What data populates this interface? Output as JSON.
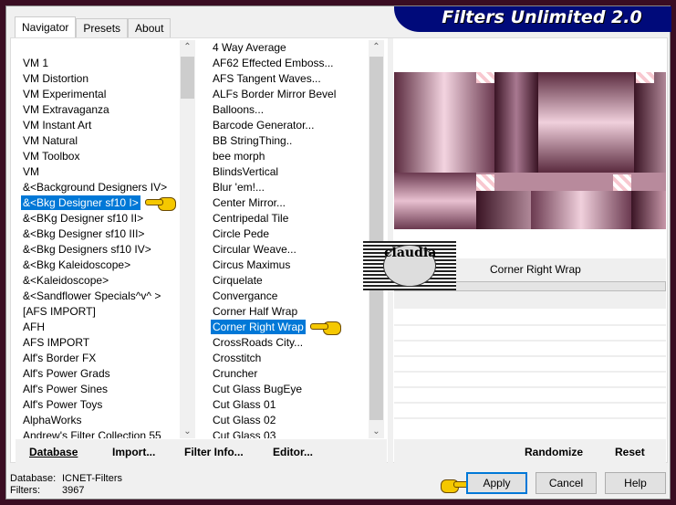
{
  "window": {
    "title": "Filters Unlimited 2.0"
  },
  "tabs": [
    {
      "label": "Navigator"
    },
    {
      "label": "Presets"
    },
    {
      "label": "About"
    }
  ],
  "categories": {
    "items": [
      "",
      "VM 1",
      "VM Distortion",
      "VM Experimental",
      "VM Extravaganza",
      "VM Instant Art",
      "VM Natural",
      "VM Toolbox",
      "VM",
      "&<Background Designers IV>",
      "&<Bkg Designer sf10 I>",
      "&<BKg Designer sf10 II>",
      "&<Bkg Designer sf10 III>",
      "&<Bkg Designers sf10 IV>",
      "&<Bkg Kaleidoscope>",
      "&<Kaleidoscope>",
      "&<Sandflower Specials^v^ >",
      "[AFS IMPORT]",
      "AFH",
      "AFS IMPORT",
      "Alf's Border FX",
      "Alf's Power Grads",
      "Alf's Power Sines",
      "Alf's Power Toys",
      "AlphaWorks",
      "Andrew's Filter Collection 55"
    ],
    "selected": "&<Bkg Designer sf10 I>"
  },
  "filters": {
    "items": [
      "4 Way Average",
      "AF62 Effected Emboss...",
      "AFS Tangent Waves...",
      "ALFs Border Mirror Bevel",
      "Balloons...",
      "Barcode Generator...",
      "BB StringThing..",
      "bee morph",
      "BlindsVertical",
      "Blur 'em!...",
      "Center Mirror...",
      "Centripedal Tile",
      "Circle Pede",
      "Circular Weave...",
      "Circus Maximus",
      "Cirquelate",
      "Convergance",
      "Corner Half Wrap",
      "Corner Right Wrap",
      "CrossRoads City...",
      "Crosstitch",
      "Cruncher",
      "Cut Glass  BugEye",
      "Cut Glass 01",
      "Cut Glass 02",
      "Cut Glass 03"
    ],
    "selected": "Corner Right Wrap"
  },
  "preview": {
    "filter_name": "Corner Right Wrap",
    "watermark": "claudia"
  },
  "toolbar": {
    "database": "Database",
    "import": "Import...",
    "filter_info": "Filter Info...",
    "editor": "Editor...",
    "randomize": "Randomize",
    "reset": "Reset"
  },
  "status": {
    "database_label": "Database:",
    "database_value": "ICNET-Filters",
    "filters_label": "Filters:",
    "filters_value": "3967"
  },
  "buttons": {
    "apply": "Apply",
    "cancel": "Cancel",
    "help": "Help"
  },
  "colors": {
    "selection": "#0078d7",
    "banner": "#000a7a",
    "frame": "#3a0d22"
  }
}
